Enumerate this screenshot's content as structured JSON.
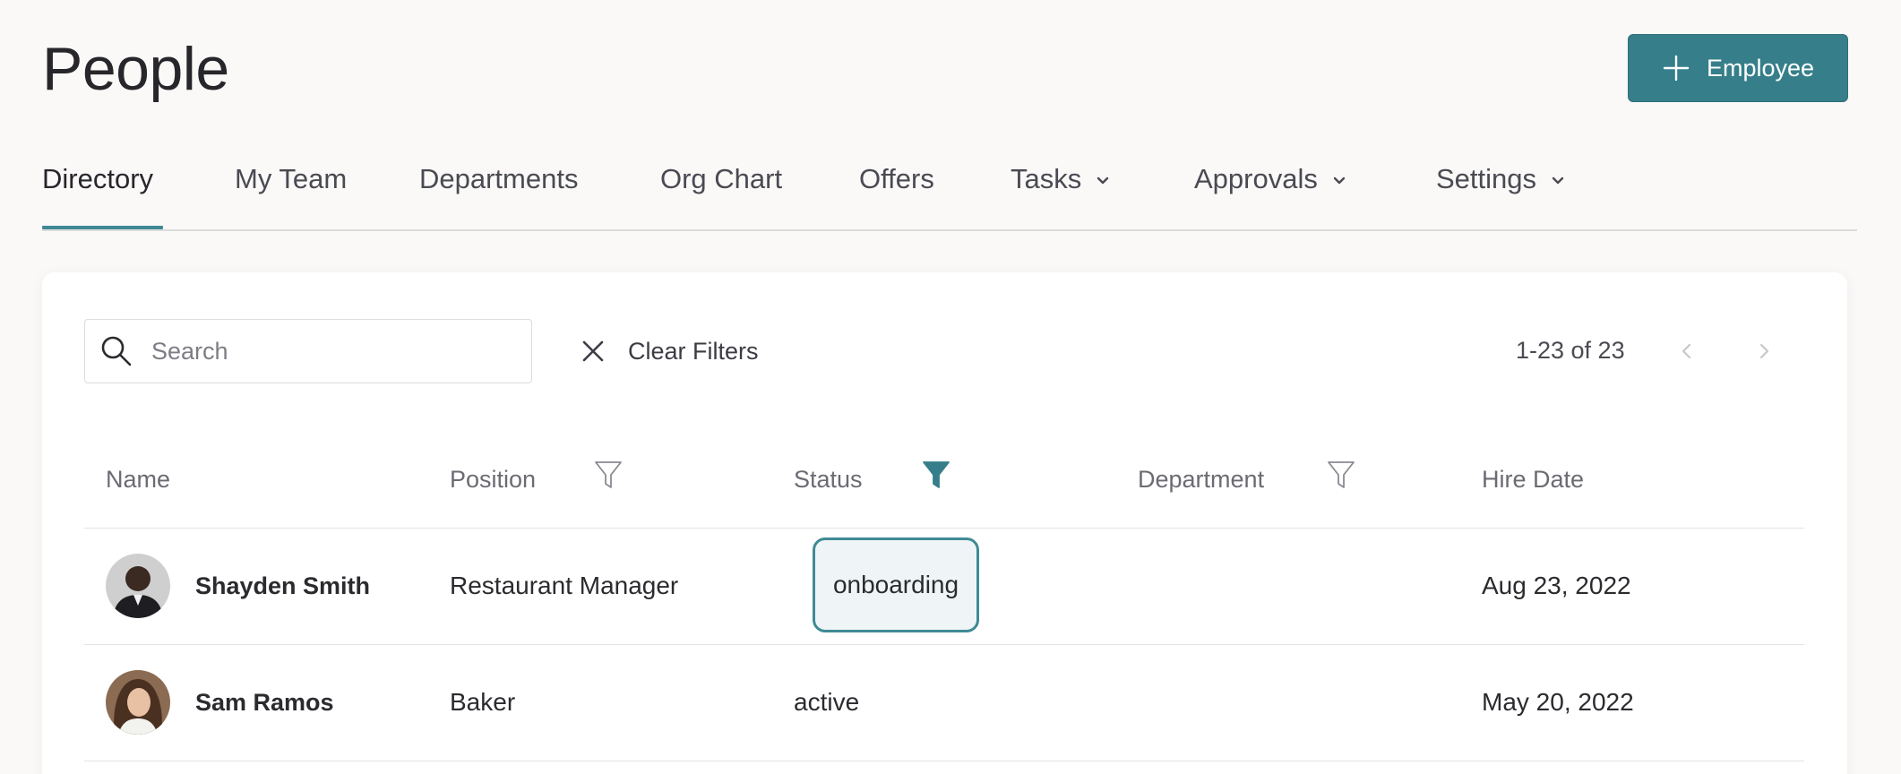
{
  "page": {
    "title": "People"
  },
  "header": {
    "add_button_label": "Employee"
  },
  "tabs": [
    {
      "label": "Directory",
      "active": true
    },
    {
      "label": "My Team"
    },
    {
      "label": "Departments"
    },
    {
      "label": "Org Chart"
    },
    {
      "label": "Offers"
    },
    {
      "label": "Tasks",
      "dropdown": true
    },
    {
      "label": "Approvals",
      "dropdown": true
    },
    {
      "label": "Settings",
      "dropdown": true
    }
  ],
  "toolbar": {
    "search_placeholder": "Search",
    "search_value": "",
    "clear_filters_label": "Clear Filters",
    "pagination_text": "1-23 of 23"
  },
  "table": {
    "columns": [
      {
        "label": "Name"
      },
      {
        "label": "Position",
        "filter_active": false
      },
      {
        "label": "Status",
        "filter_active": true
      },
      {
        "label": "Department",
        "filter_active": false
      },
      {
        "label": "Hire Date"
      }
    ],
    "rows": [
      {
        "name": "Shayden Smith",
        "position": "Restaurant Manager",
        "status": "onboarding",
        "department": "",
        "hire_date": "Aug 23, 2022",
        "status_selected": true
      },
      {
        "name": "Sam Ramos",
        "position": "Baker",
        "status": "active",
        "department": "",
        "hire_date": "May 20, 2022"
      }
    ]
  },
  "colors": {
    "accent": "#367f8a",
    "background": "#faf9f8",
    "card": "#ffffff"
  },
  "icons": {
    "add": "plus-icon",
    "search": "search-icon",
    "clear": "close-icon",
    "prev": "chevron-left-icon",
    "next": "chevron-right-icon",
    "filter": "filter-icon",
    "dropdown": "chevron-down-icon"
  }
}
